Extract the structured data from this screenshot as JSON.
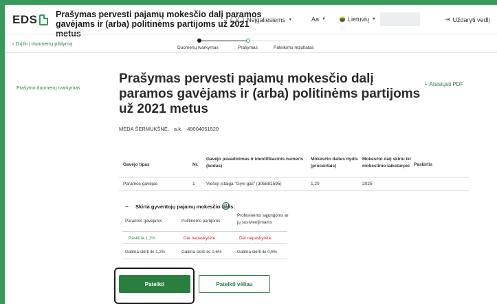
{
  "header": {
    "logo": "EDS",
    "title": "Prašymas pervesti pajamų mokesčio dalį paramos gavėjams ir (arba) politinėms partijoms už 2021 metus",
    "accessibility_label": "Neįgaliesiems",
    "font_size_label": "Aa",
    "language_label": "Lietuvių",
    "close_label": "Uždaryti vedlį"
  },
  "subheader": {
    "back_label": "Grįžti į duomenų pildymą",
    "steps": [
      "Duomenų tvarkymas",
      "Prašymas",
      "Pateikimo rezultatas"
    ]
  },
  "left_nav": {
    "label": "Prašymo duomenų tvarkymas"
  },
  "main": {
    "title": "Prašymas pervesti pajamų mokesčio dalį paramos gavėjams ir (arba) politinėms partijoms už 2021 metus",
    "download_label": "Atsisiųsti PDF",
    "person_name": "MEDA ŠERMUKŠNĖ,",
    "person_code_label": "a.k.",
    "person_code": "49004051520"
  },
  "table": {
    "headers": [
      "Gavėjo tipas",
      "Nr.",
      "Gavėjo pavadinimas ir identifikacinis numeris (kodas)",
      "Mokesčio dalies dydis (procentais)",
      "Mokesčio dalį skiriu iki mokestinio laikotarpio",
      "Paskirtis"
    ],
    "rows": [
      [
        "Paramos gavėjas",
        "1",
        "Viešoji įstaiga \"Gyvi gali\" (305881595)",
        "1,20",
        "2025",
        ""
      ]
    ]
  },
  "allocation": {
    "toggle": "–",
    "title": "Skirta gyventojų pajamų mokesčio dalis:",
    "headers": [
      "Paramos gavėjams",
      "Politinėms partijoms",
      "Profesinėms sąjungoms ar jų susivienijimams"
    ],
    "statuses": [
      "Paskirta 1,2%",
      "Dar nepaskyrėte",
      "Dar nepaskyrėte"
    ],
    "limits": [
      "Galima skirti iki 1,2%",
      "Galima skirti iki 0,6%",
      "Galima skirti iki 0,6%"
    ]
  },
  "actions": {
    "submit_label": "Pateikti",
    "later_label": "Pateikti vėliau"
  },
  "colors": {
    "brand_green": "#2a7f3f",
    "warning_red": "#d0242c",
    "page_frame": "#3a9a5b"
  }
}
